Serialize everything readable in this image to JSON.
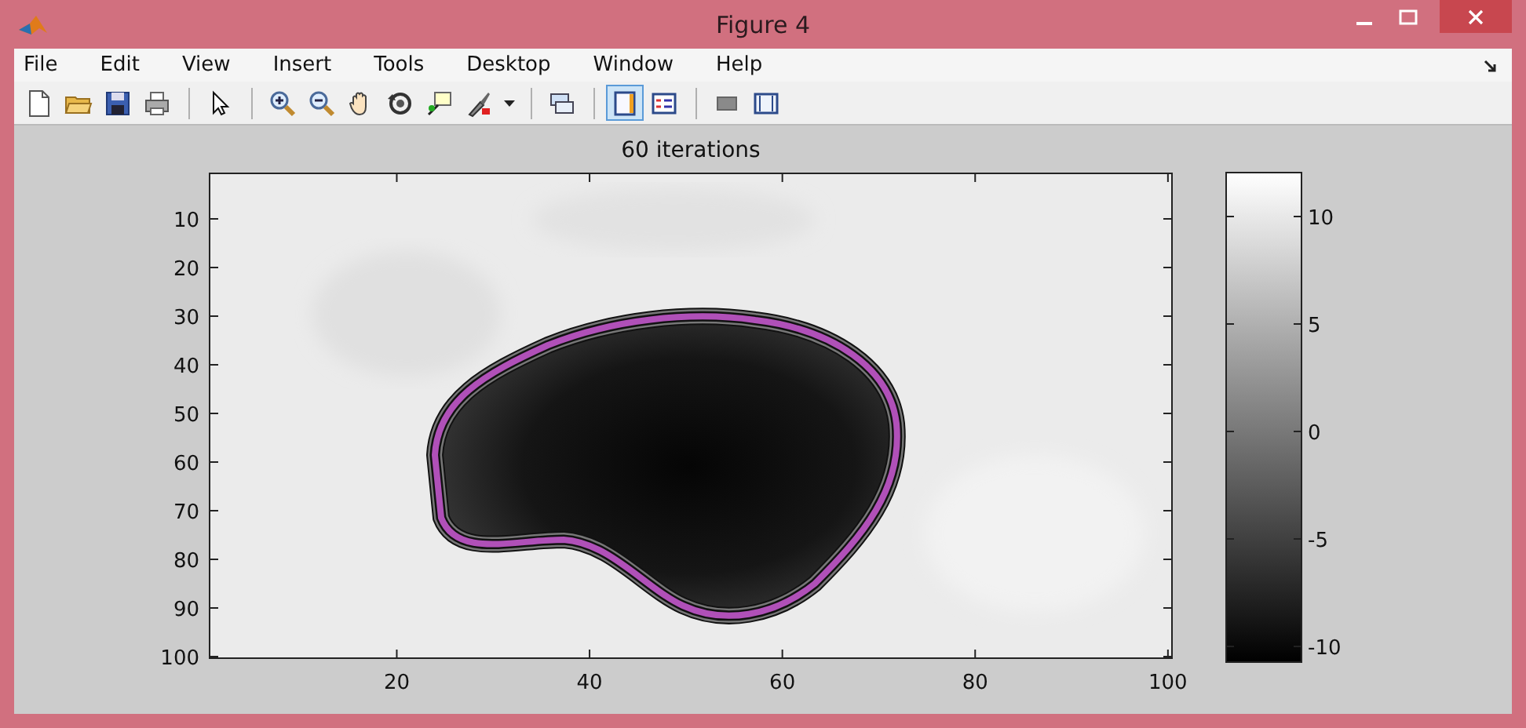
{
  "window": {
    "title": "Figure 4"
  },
  "menu": [
    "File",
    "Edit",
    "View",
    "Insert",
    "Tools",
    "Desktop",
    "Window",
    "Help"
  ],
  "toolbar": [
    {
      "kind": "new",
      "selected": false
    },
    {
      "kind": "open",
      "selected": false
    },
    {
      "kind": "save",
      "selected": false
    },
    {
      "kind": "print",
      "selected": false
    },
    {
      "kind": "sep"
    },
    {
      "kind": "pointer",
      "selected": false
    },
    {
      "kind": "sep"
    },
    {
      "kind": "zoom-in",
      "selected": false
    },
    {
      "kind": "zoom-out",
      "selected": false
    },
    {
      "kind": "pan",
      "selected": false
    },
    {
      "kind": "rotate",
      "selected": false
    },
    {
      "kind": "datacursor",
      "selected": false
    },
    {
      "kind": "brush",
      "selected": false
    },
    {
      "kind": "caret",
      "selected": false
    },
    {
      "kind": "sep"
    },
    {
      "kind": "link",
      "selected": false
    },
    {
      "kind": "sep"
    },
    {
      "kind": "colorbar",
      "selected": true
    },
    {
      "kind": "legend",
      "selected": false
    },
    {
      "kind": "sep"
    },
    {
      "kind": "hide",
      "selected": false
    },
    {
      "kind": "show",
      "selected": false
    }
  ],
  "axes": {
    "title": "60 iterations",
    "xticks": [
      "20",
      "40",
      "60",
      "80",
      "100"
    ],
    "yticks": [
      "10",
      "20",
      "30",
      "40",
      "50",
      "60",
      "70",
      "80",
      "90",
      "100"
    ],
    "colorbar_ticks": [
      "10",
      "5",
      "0",
      "-5",
      "-10"
    ]
  }
}
